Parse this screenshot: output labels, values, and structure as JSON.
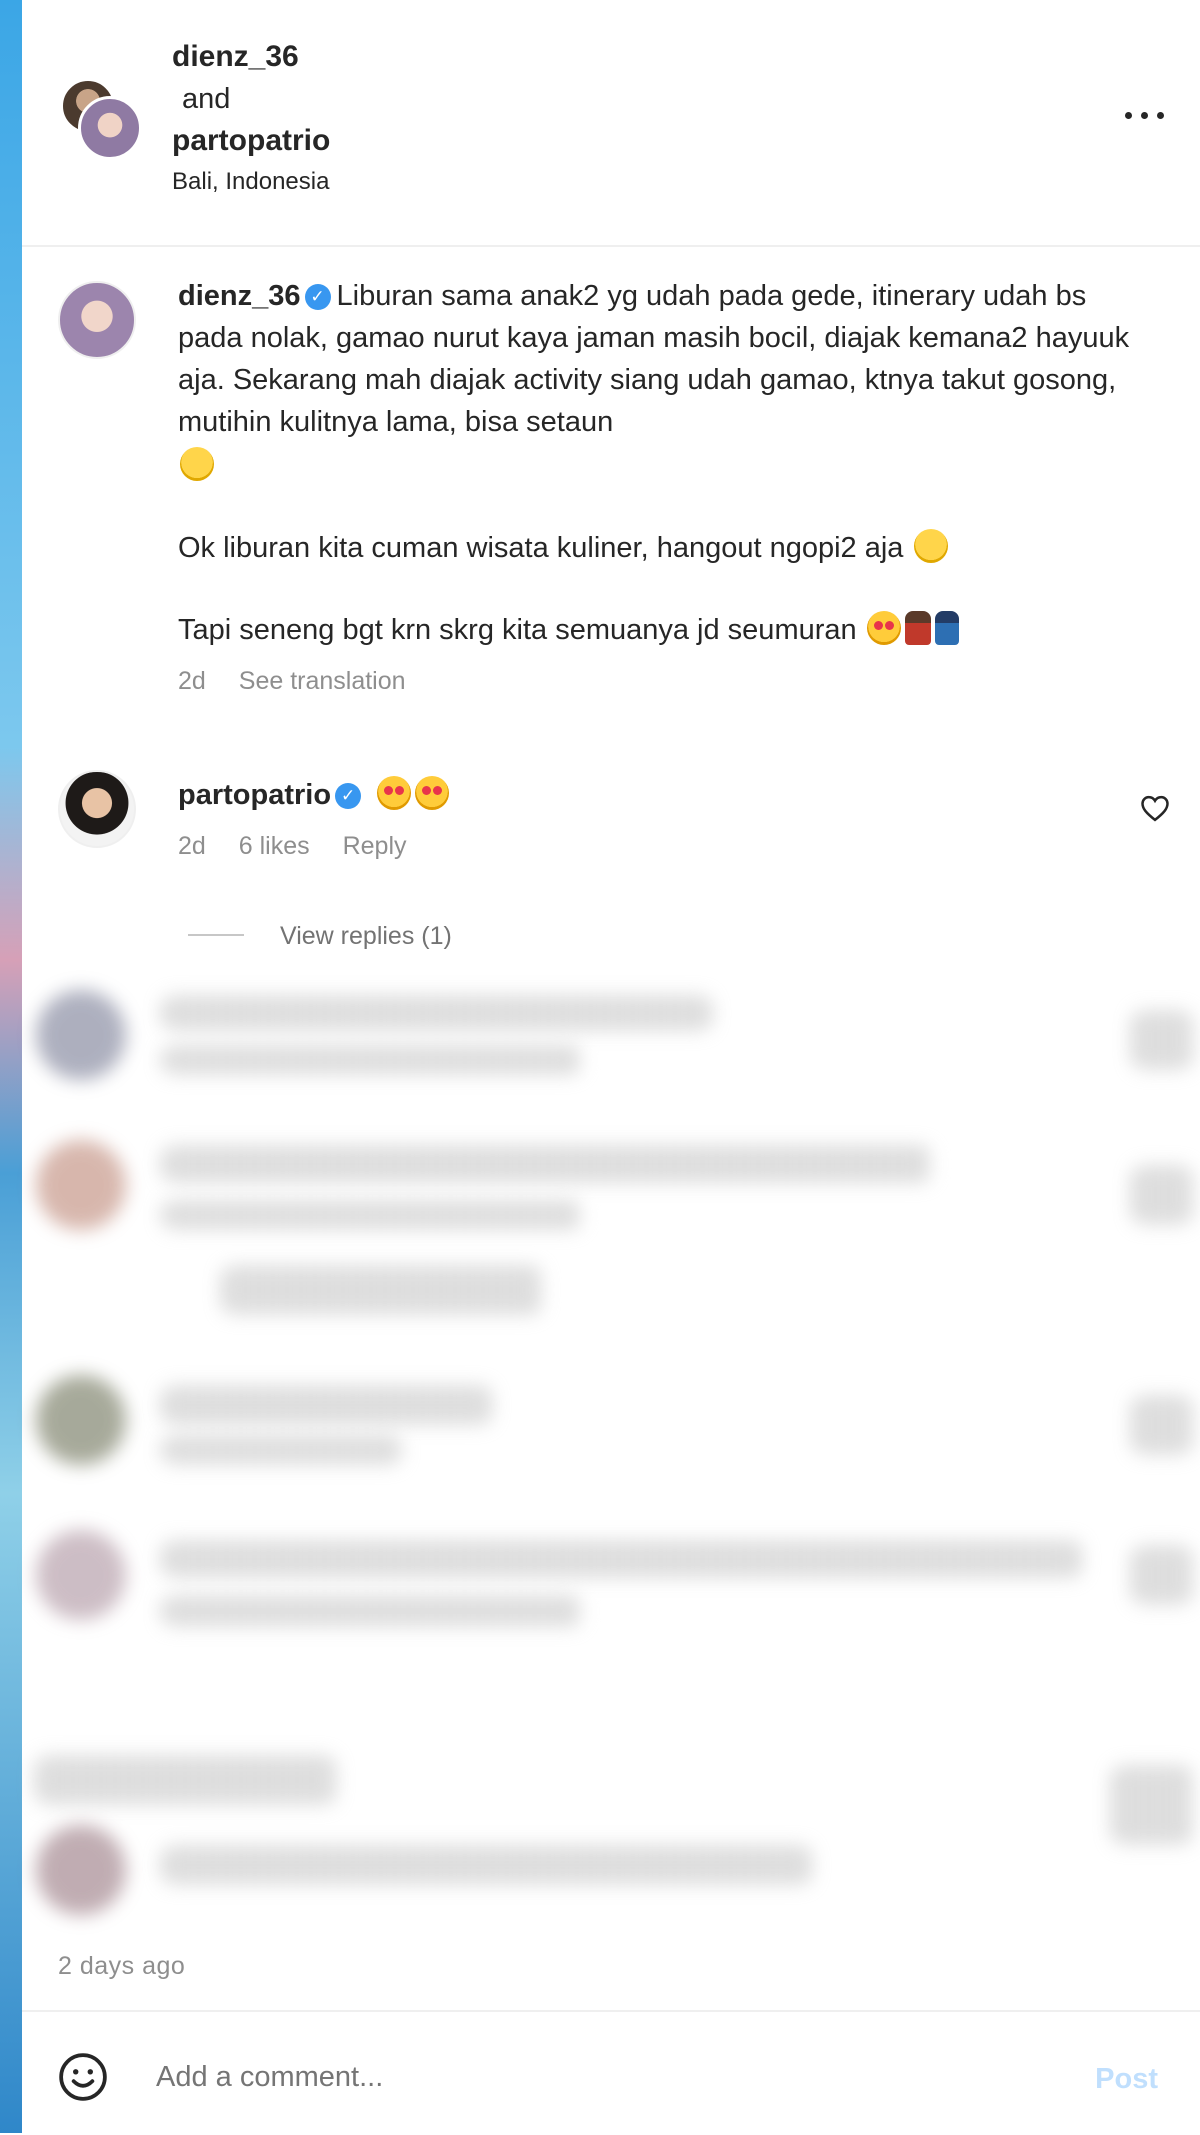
{
  "header": {
    "user1": "dienz_36",
    "and_text": "and",
    "user2": "partopatrio",
    "location": "Bali, Indonesia",
    "more_icon": "more-horizontal-icon"
  },
  "caption": {
    "username": "dienz_36",
    "verified": true,
    "paragraph1": "Liburan sama anak2 yg udah pada gede, itinerary udah bs pada nolak, gamao nurut kaya jaman masih bocil, diajak kemana2 hayuuk aja. Sekarang mah diajak activity siang udah gamao, ktnya takut gosong, mutihin kulitnya lama, bisa setaun",
    "paragraph2": "Ok liburan kita cuman wisata kuliner, hangout ngopi2 aja",
    "paragraph3": "Tapi seneng bgt krn skrg kita semuanya jd seumuran",
    "time": "2d",
    "see_translation": "See translation"
  },
  "comment1": {
    "username": "partopatrio",
    "verified": true,
    "time": "2d",
    "likes": "6 likes",
    "reply": "Reply",
    "view_replies": "View replies (1)"
  },
  "post_timestamp": "2 days ago",
  "footer": {
    "emoji_icon": "smiley-icon",
    "placeholder": "Add a comment...",
    "post_label": "Post"
  },
  "colors": {
    "verified": "#3897f0",
    "meta_text": "#8e8e8e",
    "post_disabled": "#c0dffd"
  }
}
